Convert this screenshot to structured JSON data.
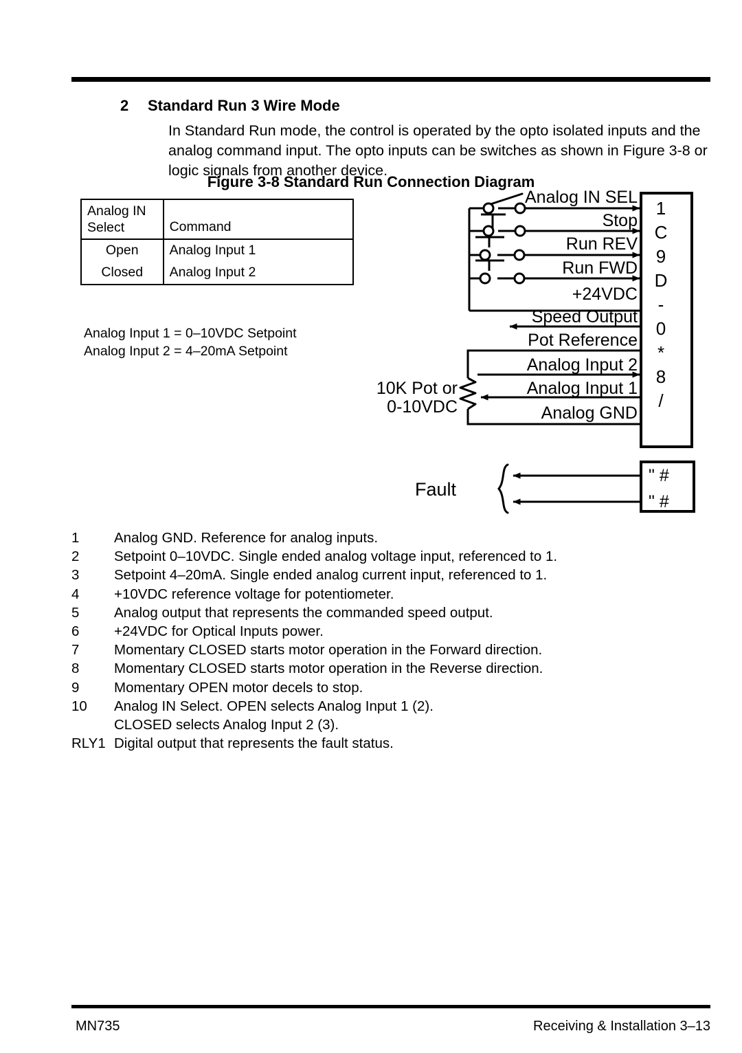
{
  "section": {
    "number": "2",
    "title": "Standard Run 3 Wire Mode",
    "paragraph": "In Standard Run mode, the control is operated by the opto isolated inputs and the analog command input.  The opto inputs can be switches as shown in Figure 3-8 or logic signals from another device."
  },
  "figure": {
    "caption_number": "Figure 3-8",
    "caption_title": "Standard Run Connection Diagram"
  },
  "analog_table": {
    "header": [
      "Analog IN Select",
      "Command"
    ],
    "header_line1": "Analog IN",
    "header_line2": "Select",
    "header_command": "Command",
    "rows": [
      {
        "select": "Open",
        "command": "Analog Input 1"
      },
      {
        "select": "Closed",
        "command": "Analog Input 2"
      }
    ]
  },
  "analog_notes": [
    "Analog Input 1 = 0–10VDC Setpoint",
    "Analog Input 2 = 4–20mA Setpoint"
  ],
  "diagram": {
    "signals": [
      {
        "label": "Analog IN SEL",
        "terminal": "1",
        "direction": "in"
      },
      {
        "label": "Stop",
        "terminal": "C",
        "direction": "in"
      },
      {
        "label": "Run REV",
        "terminal": "9",
        "direction": "in"
      },
      {
        "label": "Run FWD",
        "terminal": "D",
        "direction": "in"
      },
      {
        "label": "+24VDC",
        "terminal": "-",
        "direction": "none"
      },
      {
        "label": "Speed Output",
        "terminal": "0",
        "direction": "out"
      },
      {
        "label": "Pot Reference",
        "terminal": "*",
        "direction": "none"
      },
      {
        "label": "Analog Input 2",
        "terminal": "8",
        "direction": "in"
      },
      {
        "label": "Analog Input 1",
        "terminal": "/",
        "direction": "out"
      },
      {
        "label": "Analog GND",
        "terminal": "",
        "direction": "none"
      }
    ],
    "pot_label_line1": "10K    Pot or",
    "pot_label_line2": "0-10VDC",
    "fault_label": "Fault",
    "fault_terminals": [
      "\" #",
      "\" #"
    ]
  },
  "terminal_list": [
    {
      "num": "1",
      "text": "Analog GND. Reference for analog inputs."
    },
    {
      "num": "2",
      "text": "Setpoint 0–10VDC. Single ended analog voltage input, referenced to 1."
    },
    {
      "num": "3",
      "text": "Setpoint 4–20mA. Single ended analog current input, referenced to 1."
    },
    {
      "num": "4",
      "text": "+10VDC reference voltage for potentiometer."
    },
    {
      "num": "5",
      "text": "Analog output that represents the commanded speed output."
    },
    {
      "num": "6",
      "text": "+24VDC for Optical Inputs power."
    },
    {
      "num": "7",
      "text": "Momentary CLOSED starts motor operation in the Forward direction."
    },
    {
      "num": "8",
      "text": "Momentary CLOSED starts motor operation in the Reverse direction."
    },
    {
      "num": "9",
      "text": "Momentary OPEN motor decels to stop."
    },
    {
      "num": "10",
      "text": "Analog IN Select.  OPEN selects Analog Input 1 (2).",
      "text2": "CLOSED selects Analog Input 2 (3)."
    },
    {
      "num": "RLY1",
      "text": "Digital output that represents the fault status."
    }
  ],
  "footer": {
    "left": "MN735",
    "right": "Receiving & Installation 3–13"
  }
}
